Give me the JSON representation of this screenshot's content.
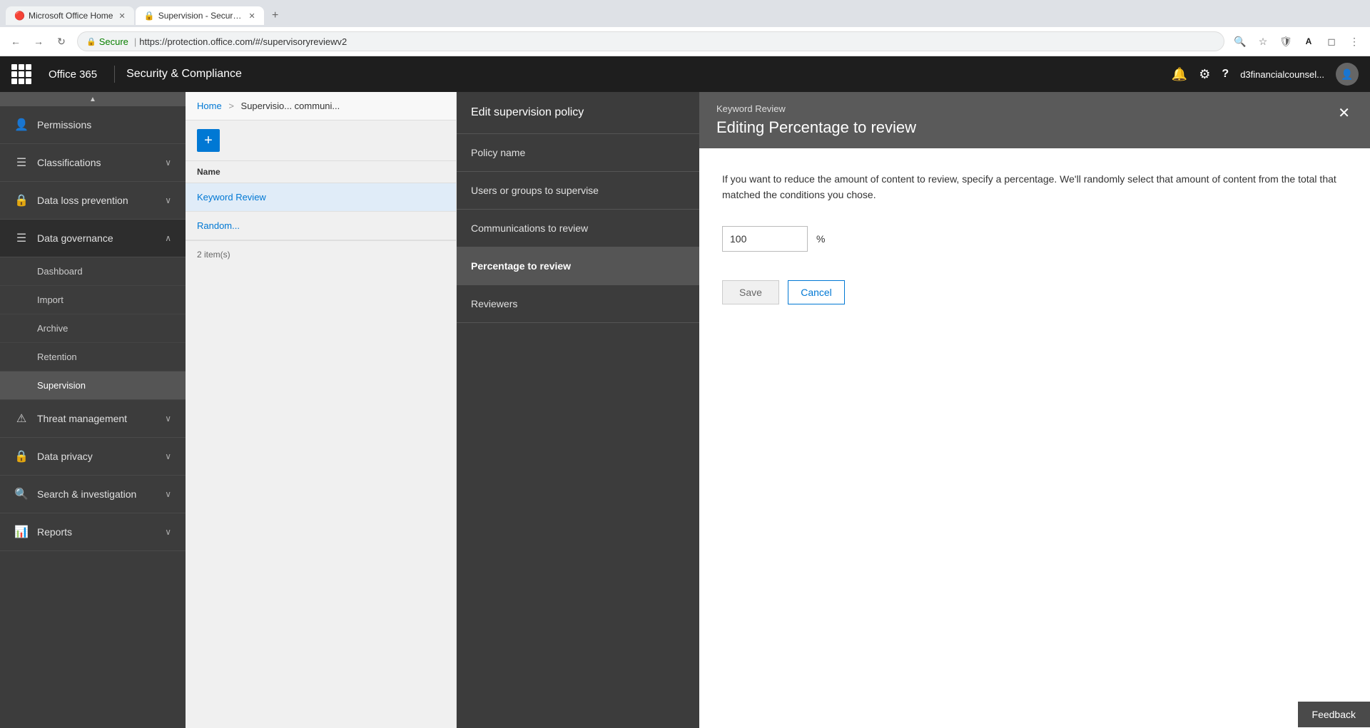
{
  "browser": {
    "tabs": [
      {
        "id": "tab1",
        "title": "Microsoft Office Home",
        "favicon": "🔴",
        "active": false
      },
      {
        "id": "tab2",
        "title": "Supervision - Security &",
        "favicon": "🔒",
        "active": true
      }
    ],
    "new_tab_label": "+",
    "back_btn": "←",
    "forward_btn": "→",
    "refresh_btn": "↻",
    "address": {
      "protocol": "Secure",
      "url": "https://protection.office.com/#/supervisoryreviewv2"
    },
    "toolbar": {
      "search_icon": "🔍",
      "star_icon": "☆",
      "ext1_icon": "🛡",
      "ext2_icon": "A",
      "ext3_icon": "◻",
      "menu_icon": "⋮"
    }
  },
  "topnav": {
    "waffle_label": "⊞",
    "office_label": "Office 365",
    "app_title": "Security & Compliance",
    "bell_icon": "🔔",
    "gear_icon": "⚙",
    "help_icon": "?",
    "user_name": "d3financialcounsel...",
    "user_avatar": "👤"
  },
  "sidebar": {
    "scroll_up": "▲",
    "items": [
      {
        "id": "permissions",
        "label": "Permissions",
        "icon": "👤",
        "has_children": false,
        "active": false
      },
      {
        "id": "classifications",
        "label": "Classifications",
        "icon": "☰",
        "has_children": true,
        "active": false
      },
      {
        "id": "dlp",
        "label": "Data loss prevention",
        "icon": "🔒",
        "has_children": true,
        "active": false
      },
      {
        "id": "data-governance",
        "label": "Data governance",
        "icon": "☰",
        "has_children": true,
        "active": true,
        "expanded": true
      },
      {
        "id": "dashboard",
        "label": "Dashboard",
        "sub": true,
        "active": false
      },
      {
        "id": "import",
        "label": "Import",
        "sub": true,
        "active": false
      },
      {
        "id": "archive",
        "label": "Archive",
        "sub": true,
        "active": false
      },
      {
        "id": "retention",
        "label": "Retention",
        "sub": true,
        "active": false
      },
      {
        "id": "supervision",
        "label": "Supervision",
        "sub": true,
        "active": true
      },
      {
        "id": "threat-management",
        "label": "Threat management",
        "icon": "⚠",
        "has_children": true,
        "active": false
      },
      {
        "id": "data-privacy",
        "label": "Data privacy",
        "icon": "🔒",
        "has_children": true,
        "active": false
      },
      {
        "id": "search-investigation",
        "label": "Search & investigation",
        "icon": "🔍",
        "has_children": true,
        "active": false
      },
      {
        "id": "reports",
        "label": "Reports",
        "icon": "📊",
        "has_children": true,
        "active": false
      }
    ]
  },
  "breadcrumb": {
    "home": "Home",
    "sep": ">",
    "current": "Supervisio... communi..."
  },
  "list_panel": {
    "add_btn": "+",
    "header_name": "Name",
    "items": [
      {
        "id": "keyword-review",
        "name": "Keyword Review",
        "active": true
      },
      {
        "id": "random-sample",
        "name": "Random...",
        "active": false
      }
    ],
    "footer": "2 item(s)"
  },
  "edit_panel": {
    "title": "Edit supervision policy",
    "steps": [
      {
        "id": "policy-name",
        "label": "Policy name",
        "active": false
      },
      {
        "id": "users-groups",
        "label": "Users or groups to supervise",
        "active": false
      },
      {
        "id": "communications",
        "label": "Communications to review",
        "active": false
      },
      {
        "id": "percentage",
        "label": "Percentage to review",
        "active": true
      },
      {
        "id": "reviewers",
        "label": "Reviewers",
        "active": false
      }
    ]
  },
  "dialog": {
    "title_small": "Keyword Review",
    "title_main": "Editing Percentage to review",
    "close_btn": "✕",
    "description": "If you want to reduce the amount of content to review, specify a percentage. We'll randomly select that amount of content from the total that matched the conditions you chose.",
    "input_value": "100",
    "input_unit": "%",
    "save_label": "Save",
    "cancel_label": "Cancel"
  },
  "feedback": {
    "label": "Feedback"
  }
}
